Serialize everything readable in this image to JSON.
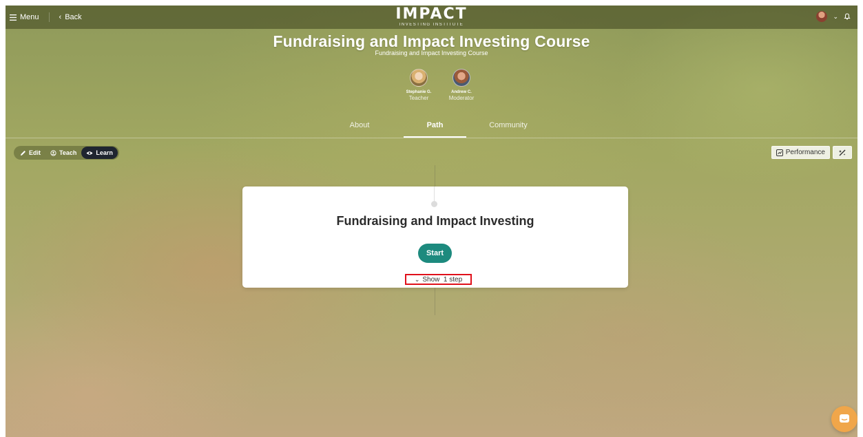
{
  "topbar": {
    "menu_label": "Menu",
    "back_label": "Back",
    "logo_main": "IMPACT",
    "logo_sub": "INVESTING INSTITUTE"
  },
  "course": {
    "title": "Fundraising and Impact Investing Course",
    "subtitle": "Fundraising and Impact Investing Course"
  },
  "people": [
    {
      "name": "Stephanie G.",
      "role": "Teacher"
    },
    {
      "name": "Andrew C.",
      "role": "Moderator"
    }
  ],
  "tabs": [
    {
      "label": "About"
    },
    {
      "label": "Path"
    },
    {
      "label": "Community"
    }
  ],
  "active_tab": "Path",
  "modes": [
    {
      "label": "Edit"
    },
    {
      "label": "Teach"
    },
    {
      "label": "Learn"
    }
  ],
  "active_mode": "Learn",
  "tools": {
    "performance_label": "Performance"
  },
  "card": {
    "title": "Fundraising and Impact Investing",
    "start_label": "Start",
    "show_steps_label": "Show  1 step"
  },
  "colors": {
    "accent": "#1d8a7e",
    "highlight_border": "#e0101a",
    "chat_button": "#f0a64a",
    "active_mode_bg": "#1f2530"
  }
}
